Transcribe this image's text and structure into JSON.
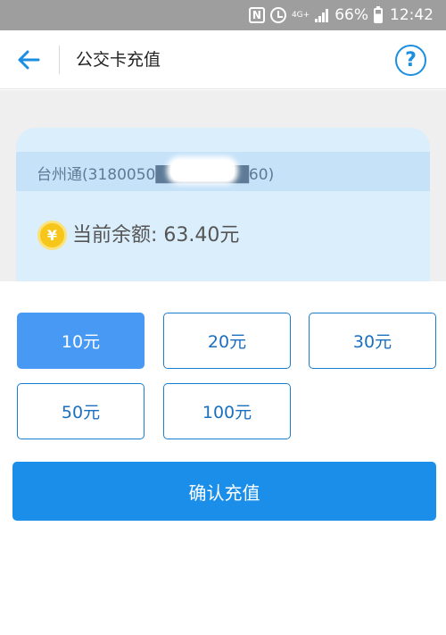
{
  "status_bar": {
    "nfc_label": "N",
    "network_label": "4G+",
    "battery_text": "66%",
    "time": "12:42"
  },
  "header": {
    "title": "公交卡充值",
    "help_label": "?"
  },
  "card": {
    "number_text": "台州通(3180050████████60)",
    "balance_text": "当前余额: 63.40元",
    "coin_symbol": "¥"
  },
  "amounts": {
    "options": [
      "10元",
      "20元",
      "30元",
      "50元",
      "100元"
    ],
    "selected": "10元"
  },
  "confirm_label": "确认充值",
  "colors": {
    "accent": "#1a8ee8",
    "selected_option": "#4899f4",
    "card_bg": "#dbeefc",
    "coin": "#f6c61a"
  }
}
